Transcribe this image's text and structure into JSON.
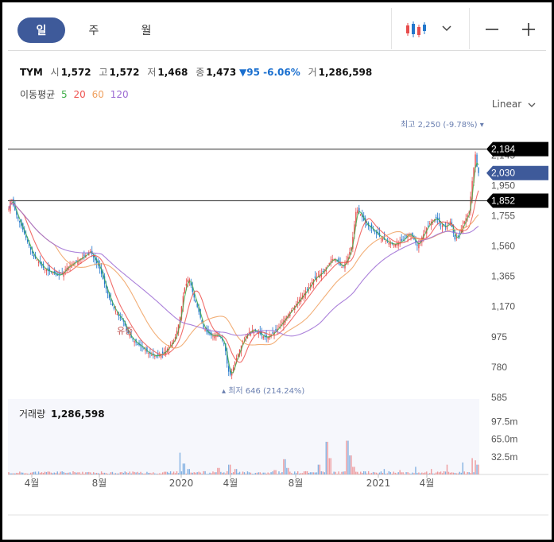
{
  "tabs": [
    {
      "label": "일",
      "active": true
    },
    {
      "label": "주"
    },
    {
      "label": "월"
    }
  ],
  "stock": {
    "name": "TYM",
    "open_label": "시",
    "open": "1,572",
    "high_label": "고",
    "high": "1,572",
    "low_label": "저",
    "low": "1,468",
    "close_label": "종",
    "close": "1,473",
    "change": "▼95 -6.06%",
    "volume_label": "거",
    "volume": "1,286,598"
  },
  "ma": {
    "label": "이동평균",
    "periods": [
      "5",
      "20",
      "60",
      "120"
    ]
  },
  "scale": {
    "label": "Linear"
  },
  "colors": {
    "up": "#e74c4c",
    "down": "#2277cc",
    "ma5": "#3fae49",
    "ma20": "#ef5350",
    "ma60": "#f0a160",
    "ma120": "#9c6bd3",
    "accent": "#3e5a9a"
  },
  "chart_data": {
    "type": "candlestick",
    "price_axis": {
      "ticks": [
        "2,145",
        "1,950",
        "1,755",
        "1,560",
        "1,365",
        "1,170",
        "975",
        "780",
        "585"
      ],
      "range": [
        585,
        2300
      ]
    },
    "time_axis": {
      "ticks": [
        "4월",
        "8월",
        "2020",
        "4월",
        "8월",
        "2021",
        "4월"
      ]
    },
    "price_labels": {
      "upper_line": "2,184",
      "current": "2,030",
      "lower_line": "1,852"
    },
    "high_annotation": "최고 2,250 (-9.78%)",
    "low_annotation": "최저 646 (214.24%)",
    "event_annotation": "유증",
    "volume": {
      "title": "거래량",
      "value": "1,286,598",
      "ticks": [
        "97.5m",
        "65.0m",
        "32.5m"
      ],
      "range": [
        0,
        130
      ]
    },
    "close_series": [
      [
        0,
        1800
      ],
      [
        3,
        1880
      ],
      [
        6,
        1820
      ],
      [
        10,
        1760
      ],
      [
        15,
        1700
      ],
      [
        20,
        1640
      ],
      [
        26,
        1560
      ],
      [
        32,
        1490
      ],
      [
        38,
        1460
      ],
      [
        44,
        1420
      ],
      [
        50,
        1400
      ],
      [
        56,
        1390
      ],
      [
        62,
        1370
      ],
      [
        68,
        1380
      ],
      [
        74,
        1420
      ],
      [
        80,
        1440
      ],
      [
        86,
        1460
      ],
      [
        92,
        1480
      ],
      [
        98,
        1500
      ],
      [
        104,
        1530
      ],
      [
        110,
        1470
      ],
      [
        116,
        1420
      ],
      [
        122,
        1320
      ],
      [
        128,
        1230
      ],
      [
        134,
        1160
      ],
      [
        140,
        1110
      ],
      [
        146,
        1080
      ],
      [
        152,
        1000
      ],
      [
        158,
        960
      ],
      [
        164,
        930
      ],
      [
        170,
        910
      ],
      [
        176,
        880
      ],
      [
        182,
        860
      ],
      [
        188,
        850
      ],
      [
        194,
        860
      ],
      [
        200,
        880
      ],
      [
        206,
        920
      ],
      [
        212,
        960
      ],
      [
        218,
        1080
      ],
      [
        224,
        1280
      ],
      [
        230,
        1360
      ],
      [
        236,
        1240
      ],
      [
        242,
        1150
      ],
      [
        248,
        1040
      ],
      [
        254,
        1000
      ],
      [
        260,
        980
      ],
      [
        266,
        990
      ],
      [
        272,
        960
      ],
      [
        276,
        920
      ],
      [
        280,
        760
      ],
      [
        284,
        720
      ],
      [
        288,
        800
      ],
      [
        294,
        880
      ],
      [
        300,
        960
      ],
      [
        306,
        1000
      ],
      [
        312,
        1020
      ],
      [
        318,
        1010
      ],
      [
        324,
        980
      ],
      [
        330,
        970
      ],
      [
        336,
        990
      ],
      [
        342,
        1020
      ],
      [
        348,
        1060
      ],
      [
        354,
        1100
      ],
      [
        360,
        1140
      ],
      [
        366,
        1180
      ],
      [
        372,
        1220
      ],
      [
        378,
        1260
      ],
      [
        384,
        1300
      ],
      [
        390,
        1350
      ],
      [
        396,
        1370
      ],
      [
        402,
        1400
      ],
      [
        408,
        1440
      ],
      [
        414,
        1480
      ],
      [
        420,
        1460
      ],
      [
        426,
        1420
      ],
      [
        432,
        1470
      ],
      [
        438,
        1560
      ],
      [
        444,
        1800
      ],
      [
        450,
        1760
      ],
      [
        456,
        1700
      ],
      [
        462,
        1680
      ],
      [
        468,
        1650
      ],
      [
        474,
        1620
      ],
      [
        480,
        1600
      ],
      [
        486,
        1580
      ],
      [
        492,
        1570
      ],
      [
        498,
        1580
      ],
      [
        504,
        1600
      ],
      [
        510,
        1640
      ],
      [
        516,
        1620
      ],
      [
        522,
        1560
      ],
      [
        528,
        1620
      ],
      [
        534,
        1680
      ],
      [
        540,
        1720
      ],
      [
        546,
        1740
      ],
      [
        552,
        1700
      ],
      [
        558,
        1680
      ],
      [
        564,
        1720
      ],
      [
        570,
        1600
      ],
      [
        576,
        1640
      ],
      [
        582,
        1720
      ],
      [
        588,
        1780
      ],
      [
        592,
        1980
      ],
      [
        596,
        2150
      ],
      [
        599,
        2030
      ]
    ],
    "volume_series": [
      [
        3,
        2
      ],
      [
        10,
        3
      ],
      [
        20,
        2
      ],
      [
        40,
        3
      ],
      [
        66,
        5
      ],
      [
        90,
        4
      ],
      [
        120,
        3
      ],
      [
        150,
        4
      ],
      [
        180,
        3
      ],
      [
        200,
        5
      ],
      [
        219,
        40
      ],
      [
        224,
        20
      ],
      [
        230,
        10
      ],
      [
        250,
        6
      ],
      [
        268,
        12
      ],
      [
        282,
        18
      ],
      [
        290,
        10
      ],
      [
        320,
        4
      ],
      [
        340,
        8
      ],
      [
        352,
        28
      ],
      [
        356,
        12
      ],
      [
        380,
        6
      ],
      [
        396,
        18
      ],
      [
        406,
        60
      ],
      [
        410,
        30
      ],
      [
        432,
        62
      ],
      [
        436,
        35
      ],
      [
        440,
        14
      ],
      [
        460,
        6
      ],
      [
        480,
        10
      ],
      [
        500,
        8
      ],
      [
        520,
        14
      ],
      [
        540,
        10
      ],
      [
        560,
        18
      ],
      [
        580,
        22
      ],
      [
        592,
        30
      ],
      [
        596,
        26
      ],
      [
        599,
        18
      ]
    ]
  }
}
